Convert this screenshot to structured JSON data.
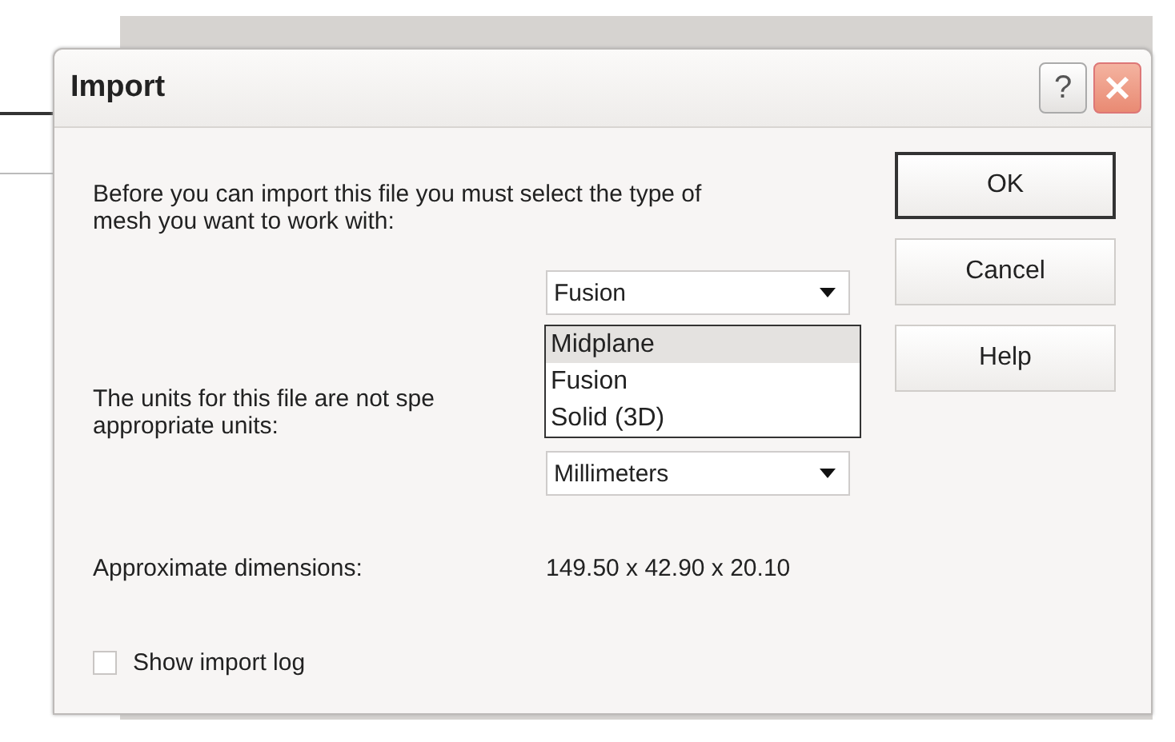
{
  "window": {
    "title": "Import",
    "help_glyph": "?"
  },
  "mesh": {
    "prompt": "Before you can import this file you must select the type of mesh you want to work with:",
    "value": "Fusion",
    "open": true,
    "options": [
      {
        "label": "Midplane",
        "highlighted": true
      },
      {
        "label": "Fusion",
        "highlighted": false
      },
      {
        "label": "Solid (3D)",
        "highlighted": false
      }
    ]
  },
  "units": {
    "prompt_lines": [
      "The units for this file are not spe",
      "appropriate units:"
    ],
    "value": "Millimeters"
  },
  "dimensions": {
    "label": "Approximate dimensions:",
    "value": "149.50 x 42.90 x 20.10"
  },
  "show_log": {
    "label": "Show import log",
    "checked": false
  },
  "buttons": [
    {
      "label": "OK",
      "default": true
    },
    {
      "label": "Cancel",
      "default": false
    },
    {
      "label": "Help",
      "default": false
    }
  ]
}
